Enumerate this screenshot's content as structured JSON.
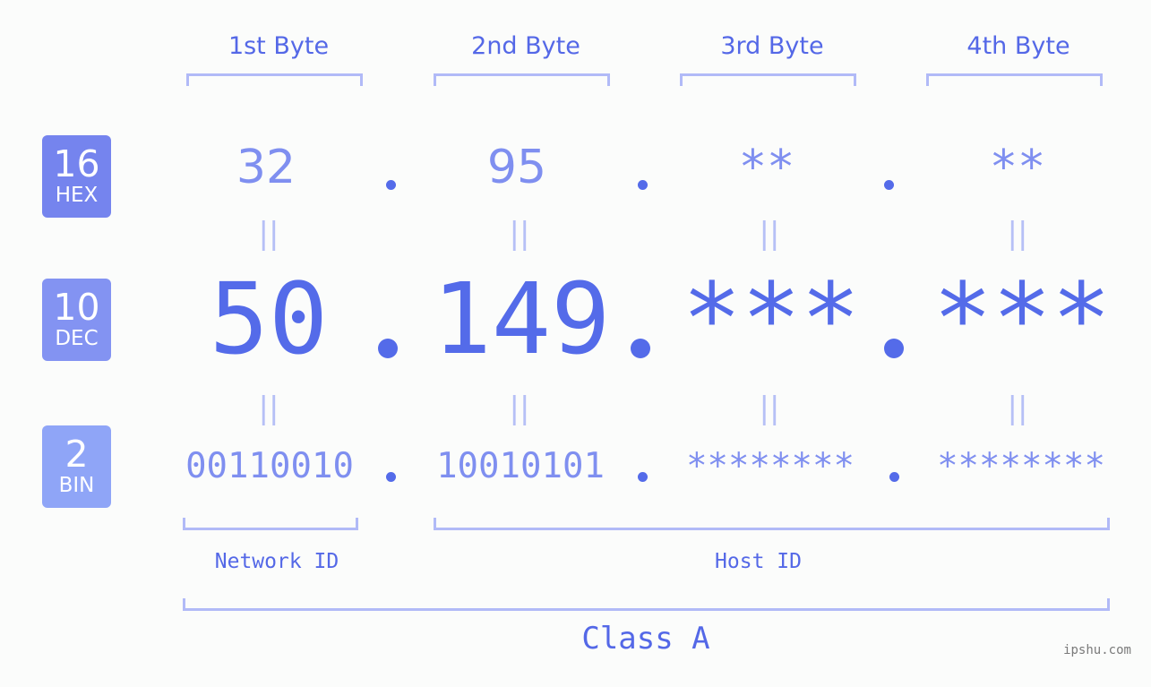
{
  "headers": [
    "1st Byte",
    "2nd Byte",
    "3rd Byte",
    "4th Byte"
  ],
  "bases": [
    {
      "number": "16",
      "label": "HEX",
      "color": "#7584ee"
    },
    {
      "number": "10",
      "label": "DEC",
      "color": "#8393f2"
    },
    {
      "number": "2",
      "label": "BIN",
      "color": "#8fa5f7"
    }
  ],
  "hex": [
    "32",
    "95",
    "**",
    "**"
  ],
  "dec": [
    "50",
    "149",
    "***",
    "***"
  ],
  "bin": [
    "00110010",
    "10010101",
    "********",
    "********"
  ],
  "equals_symbol": "||",
  "network_label": "Network ID",
  "host_label": "Host ID",
  "class_label": "Class A",
  "watermark": "ipshu.com",
  "colors": {
    "accent": "#546be9",
    "bracket": "#b1baf7",
    "light_text": "#7f8ff0",
    "background": "#fbfcfb"
  }
}
